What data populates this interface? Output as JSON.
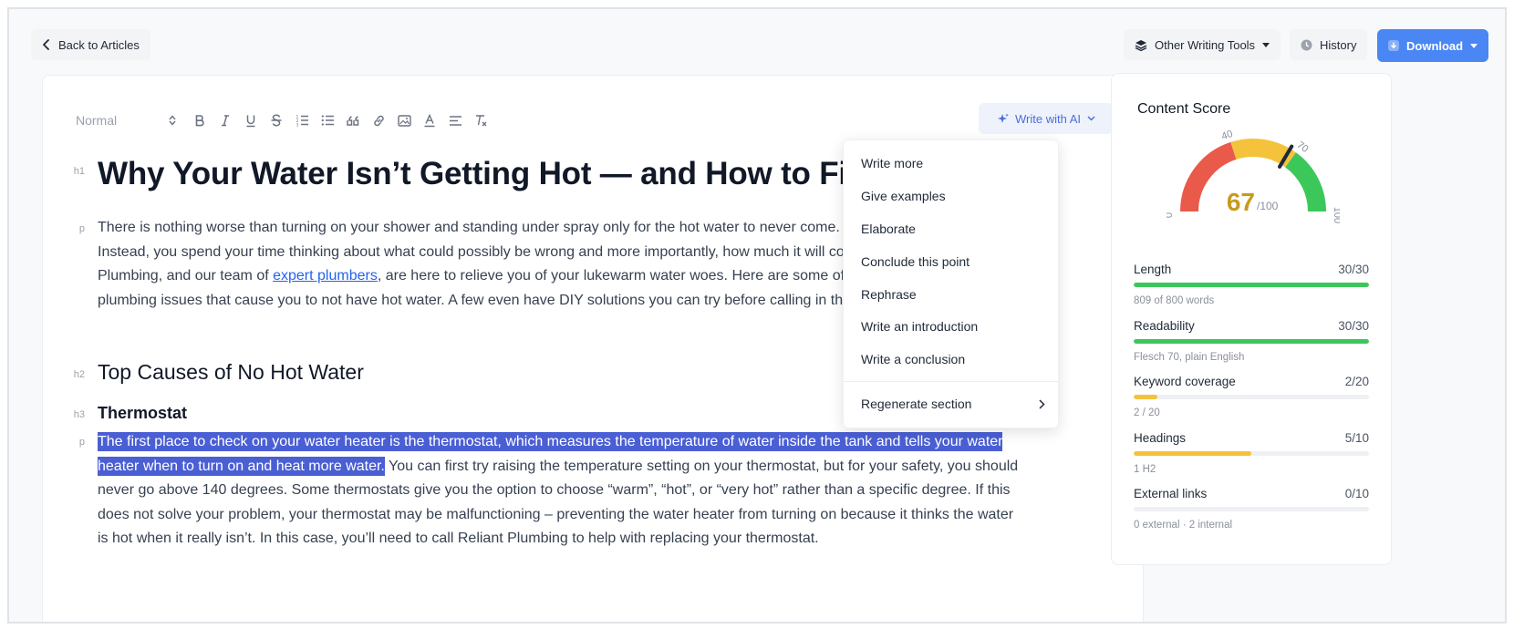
{
  "topbar": {
    "back_label": "Back to Articles",
    "tools_label": "Other Writing Tools",
    "history_label": "History",
    "download_label": "Download"
  },
  "toolbar": {
    "format_value": "Normal",
    "icons": [
      "bold-icon",
      "italic-icon",
      "underline-icon",
      "strikethrough-icon",
      "ordered-list-icon",
      "bullet-list-icon",
      "quote-icon",
      "link-icon",
      "image-icon",
      "text-color-icon",
      "align-icon",
      "clear-format-icon"
    ],
    "ai_label": "Write with AI"
  },
  "document": {
    "tags": {
      "h1": "h1",
      "p": "p",
      "h2": "h2",
      "h3": "h3"
    },
    "h1": "Why Your Water Isn’t Getting Hot — and How to Fix It",
    "intro_before_link": "There is nothing worse than turning on your shower and standing under spray only for the hot water to never come. No relaxing shower! Instead, you spend your time thinking about what could possibly be wrong and more importantly, how much it will cost to fix it. Reliant Plumbing, and our team of ",
    "intro_link": "expert plumbers",
    "intro_after_link": ", are here to relieve you of your lukewarm water woes. Here are some of the most common plumbing issues that cause you to not have hot water. A few even have DIY solutions you can try before calling in the pros!",
    "h2": "Top Causes of No Hot Water",
    "h3": "Thermostat",
    "selected_text": "The first place to check on your water heater is the thermostat, which measures the temperature of water inside the tank and tells your water heater when to turn on and heat more water.",
    "rest_text": " You can first try raising the temperature setting on your thermostat, but for your safety, you should never go above 140 degrees. Some thermostats give you the option to choose “warm”, “hot”, or “very hot” rather than a specific degree. If this does not solve your problem, your thermostat may be malfunctioning – preventing the water heater from turning on because it thinks the water is hot when it really isn’t. In this case, you’ll need to call Reliant Plumbing to help with replacing your thermostat."
  },
  "ai_menu": {
    "items": [
      "Write more",
      "Give examples",
      "Elaborate",
      "Conclude this point",
      "Rephrase",
      "Write an introduction",
      "Write a conclusion"
    ],
    "regenerate": "Regenerate section"
  },
  "score": {
    "title": "Content Score",
    "value": 67,
    "value_label": "67",
    "max_label": "/100",
    "gauge_ticks": [
      "0",
      "40",
      "70",
      "100"
    ],
    "colors": {
      "red": "#e95a4b",
      "yellow": "#f5c33b",
      "green": "#3cc75a",
      "value": "#c79a1e"
    },
    "metrics": [
      {
        "name": "Length",
        "score": "30/30",
        "fraction": 1.0,
        "color": "#3cc75a",
        "sub": "809 of 800 words"
      },
      {
        "name": "Readability",
        "score": "30/30",
        "fraction": 1.0,
        "color": "#3cc75a",
        "sub": "Flesch 70, plain English"
      },
      {
        "name": "Keyword coverage",
        "score": "2/20",
        "fraction": 0.1,
        "color": "#f5c33b",
        "sub": "2 / 20"
      },
      {
        "name": "Headings",
        "score": "5/10",
        "fraction": 0.5,
        "color": "#f5c33b",
        "sub": "1 H2"
      },
      {
        "name": "External links",
        "score": "0/10",
        "fraction": 0.0,
        "color": "#3cc75a",
        "sub": "0 external · 2 internal"
      }
    ]
  }
}
